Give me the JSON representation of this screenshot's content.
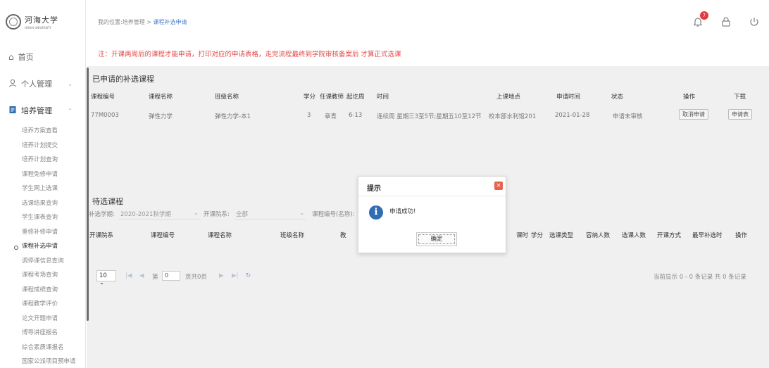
{
  "logo": {
    "name_cn": "河海大学",
    "name_en": "HOHAI UNIVERSITY"
  },
  "sidebar": {
    "home": "首页",
    "personal": "个人管理",
    "training": "培养管理",
    "items": [
      "培养方案查看",
      "培养计划提交",
      "培养计划查询",
      "课程免修申请",
      "学生网上选课",
      "选课结果查询",
      "学生课表查询",
      "重修补修申请",
      "课程补选申请",
      "调停课信息查询",
      "课程考场查询",
      "课程成绩查询",
      "课程教学评价",
      "论文开题申请",
      "博导讲座报名",
      "综合素质课报名",
      "国家公派项目预申请"
    ]
  },
  "header": {
    "breadcrumb_prefix": "我的位置:培养管理 > ",
    "breadcrumb_current": "课程补选申请",
    "notification_count": "7"
  },
  "notice": "注：开课两周后的课程才能申请，打印对应的申请表格，走完流程最终到学院审核备案后 才算正式选课",
  "applied": {
    "title": "已申请的补选课程",
    "columns": [
      "课程编号",
      "课程名称",
      "班级名称",
      "学分",
      "任课教师",
      "起讫周",
      "时间",
      "上课地点",
      "申请时间",
      "状态",
      "操作",
      "下载"
    ],
    "rows": [
      {
        "code": "77M0003",
        "name": "弹性力学",
        "class": "弹性力学-本1",
        "credit": "3",
        "teacher": "章青",
        "weeks": "6-13",
        "time": "连续周 星期三3至5节;星期五10至12节",
        "place": "校本部水利馆201",
        "date": "2021-01-28",
        "status": "申请未审核",
        "action": "取消申请",
        "download": "申请表"
      }
    ]
  },
  "pending": {
    "title": "待选课程",
    "term_label": "补选学期:",
    "term_value": "2020-2021秋学期",
    "college_label": "开课院系:",
    "college_value": "全部",
    "code_label": "课程编号(名称):",
    "columns": [
      "开课院系",
      "课程编号",
      "课程名称",
      "班级名称",
      "教",
      "课时",
      "学分",
      "选课类型",
      "容纳人数",
      "选课人数",
      "开课方式",
      "最早补选时",
      "操作"
    ]
  },
  "pager": {
    "size": "10",
    "page_prefix": "第",
    "page_value": "0",
    "page_suffix": "页共0页",
    "info": "当前显示 0 - 0 条记录 共 0 条记录"
  },
  "dialog": {
    "title": "提示",
    "message": "申请成功!",
    "ok": "确定"
  },
  "colors": {
    "notice": "#e24a4a",
    "accent": "#2f6db5",
    "badge": "#e5383b"
  }
}
